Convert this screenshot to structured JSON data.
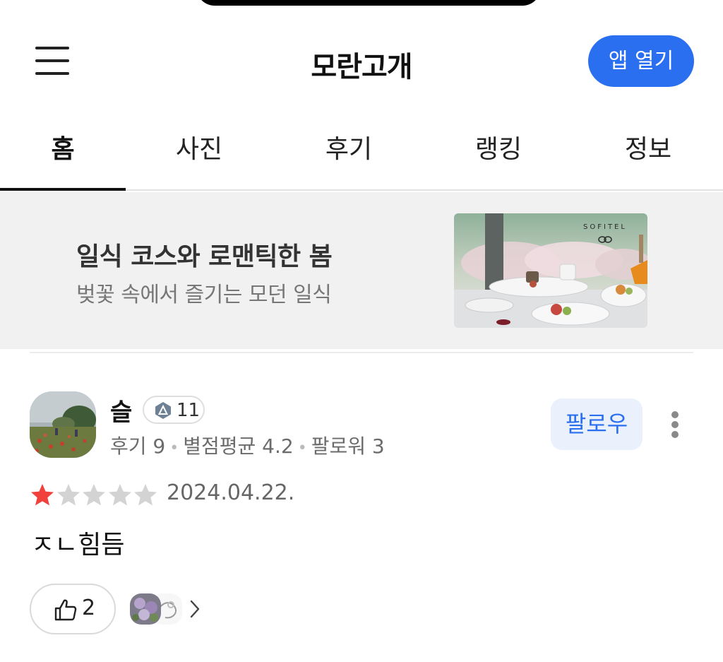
{
  "header": {
    "title": "모란고개",
    "open_app_label": "앱 열기"
  },
  "tabs": [
    {
      "label": "홈",
      "active": true
    },
    {
      "label": "사진",
      "active": false
    },
    {
      "label": "후기",
      "active": false
    },
    {
      "label": "랭킹",
      "active": false
    },
    {
      "label": "정보",
      "active": false
    }
  ],
  "banner": {
    "title": "일식 코스와 로맨틱한 봄",
    "subtitle": "벚꽃 속에서 즐기는 모던 일식",
    "image_brand": "SOFITEL"
  },
  "review": {
    "user_name": "슬",
    "level": "11",
    "stats": {
      "reviews": "후기 9",
      "avg_rating": "별점평균 4.2",
      "followers": "팔로워 3"
    },
    "follow_label": "팔로우",
    "rating": 1,
    "rating_max": 5,
    "date": "2024.04.22.",
    "text": "ㅈㄴ힘듬",
    "likes": "2"
  },
  "colors": {
    "accent": "#2a6ff0",
    "follow_bg": "#eaf1fd",
    "star_filled": "#f0413c",
    "star_empty": "#d3d3d3",
    "banner_bg": "#f1f1f1"
  },
  "icons": {
    "menu": "hamburger-icon",
    "level": "triangle-badge-icon",
    "more": "vertical-dots-icon",
    "like": "thumbs-up-icon",
    "chevron": "chevron-right-icon"
  }
}
